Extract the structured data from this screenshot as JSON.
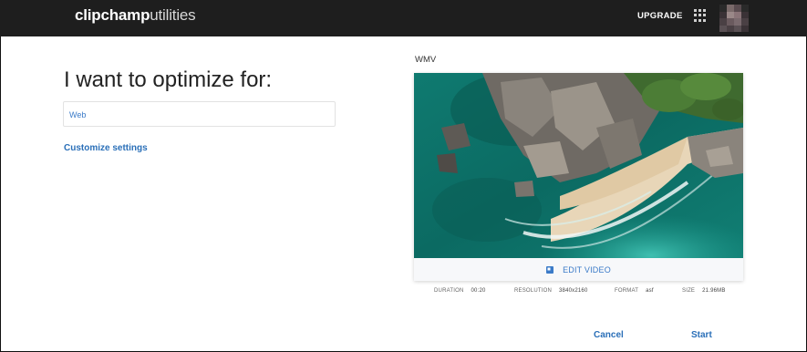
{
  "header": {
    "logo_brand": "clipchamp",
    "logo_suffix": "utilities",
    "upgrade_label": "UPGRADE",
    "apps_icon": "grid-icon",
    "avatar_icon": "avatar-pixelated"
  },
  "main": {
    "heading": "I want to optimize for:",
    "optimize_value": "Web",
    "customize_link": "Customize settings"
  },
  "preview": {
    "format": "WMV",
    "edit_label": "EDIT VIDEO",
    "edit_icon": "edit-video-icon",
    "meta": {
      "duration_label": "DURATION",
      "duration_value": "00:20",
      "resolution_label": "RESOLUTION",
      "resolution_value": "3840x2160",
      "format_label": "FORMAT",
      "format_value": "asf",
      "size_label": "SIZE",
      "size_value": "21.96MB"
    }
  },
  "actions": {
    "cancel_label": "Cancel",
    "start_label": "Start"
  },
  "colors": {
    "topbar": "#1e1e1e",
    "link_blue": "#2a6fb8",
    "water": "#0d6b62",
    "sand": "#e8d6b8"
  }
}
